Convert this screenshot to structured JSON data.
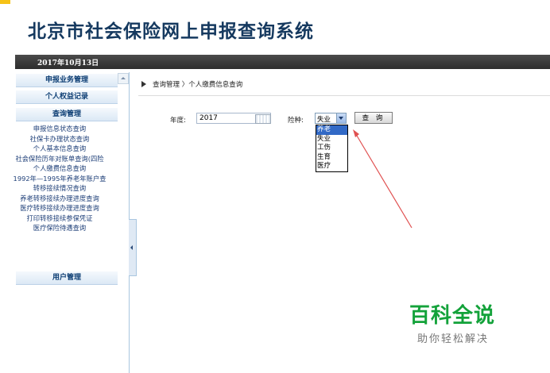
{
  "app": {
    "title": "北京市社会保险网上申报查询系统",
    "date": "2017年10月13日"
  },
  "sidebar": {
    "sections": [
      {
        "label": "申报业务管理"
      },
      {
        "label": "个人权益记录"
      },
      {
        "label": "查询管理"
      },
      {
        "label": "用户管理"
      }
    ],
    "items": [
      "申报信息状态查询",
      "社保卡办理状态查询",
      "个人基本信息查询",
      "社会保险历年对账单查询(四险",
      "个人缴费信息查询",
      "1992年—1995年养老年账户查",
      "转移接续情况查询",
      "养老转移接续办理进度查询",
      "医疗转移接续办理进度查询",
      "打印转移接续参保凭证",
      "医疗保险待遇查询"
    ]
  },
  "breadcrumb": "查询管理 〉个人缴费信息查询",
  "form": {
    "year_label": "年度:",
    "year_value": "2017",
    "type_label": "险种:",
    "type_selected": "失业",
    "query_button": "查 询",
    "type_options": [
      "养老",
      "失业",
      "工伤",
      "生育",
      "医疗"
    ]
  },
  "watermark": {
    "title": "百科全说",
    "subtitle": "助你轻松解决"
  },
  "colors": {
    "accent_text": "#0c3d73",
    "date_bar": "#3a3a3a",
    "selected_option": "#3169c6",
    "arrow": "#e05050",
    "watermark": "#13a23a"
  }
}
